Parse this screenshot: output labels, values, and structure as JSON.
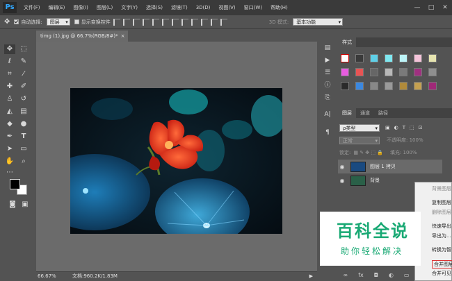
{
  "app": {
    "logo": "Ps"
  },
  "menubar": [
    "文件(F)",
    "编辑(E)",
    "图像(I)",
    "图层(L)",
    "文字(Y)",
    "选择(S)",
    "滤镜(T)",
    "3D(D)",
    "视图(V)",
    "窗口(W)",
    "帮助(H)"
  ],
  "window_controls": {
    "minimize": "—",
    "maximize": "□",
    "close": "✕"
  },
  "options": {
    "auto_select_label": "自动选择:",
    "auto_select_value": "图层",
    "show_transform_label": "显示变换控件",
    "mode_3d_label": "3D 模式:",
    "workspace_value": "基本功能"
  },
  "document": {
    "tab_title": "timg (1).jpg @ 66.7%(RGB/8#)",
    "tab_mark": "*",
    "tab_close": "×",
    "zoom": "66.67%",
    "doc_info": "文档:960.2K/1.83M",
    "status_arrow": "▶"
  },
  "styles_panel": {
    "tab": "样式"
  },
  "layers_panel": {
    "tabs": [
      "图层",
      "通道",
      "路径"
    ],
    "filter_label": "ρ类型",
    "blend_mode": "正常",
    "opacity_label": "不透明度: 100%",
    "lock_label": "锁定:",
    "fill_label": "填充: 100%",
    "layers": [
      {
        "name": "图层 1 拷贝"
      },
      {
        "name": "背景"
      }
    ]
  },
  "context_menu": {
    "items": [
      "背景图层",
      "复制图层",
      "删除图层",
      "快速导出",
      "导出为...",
      "转换为智",
      "合并图层",
      "合并可见"
    ]
  },
  "watermark": {
    "main": "百科全说",
    "sub": "助你轻松解决"
  },
  "colors": {
    "accent": "#31a8ff",
    "watermark": "#19a974"
  }
}
